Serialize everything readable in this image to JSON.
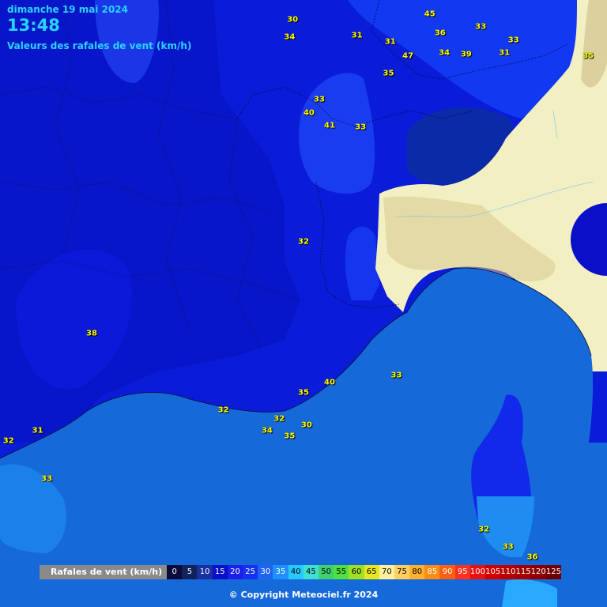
{
  "header": {
    "date": "dimanche 19 mai 2024",
    "time": "13:48",
    "subtitle": "Valeurs des rafales de vent (km/h)"
  },
  "labels": [
    {
      "text": "30",
      "lon": 0.482,
      "lat": 0.032
    },
    {
      "text": "34",
      "lon": 0.477,
      "lat": 0.061
    },
    {
      "text": "31",
      "lon": 0.588,
      "lat": 0.058
    },
    {
      "text": "31",
      "lon": 0.643,
      "lat": 0.069
    },
    {
      "text": "45",
      "lon": 0.708,
      "lat": 0.023
    },
    {
      "text": "36",
      "lon": 0.725,
      "lat": 0.055
    },
    {
      "text": "33",
      "lon": 0.792,
      "lat": 0.044
    },
    {
      "text": "33",
      "lon": 0.846,
      "lat": 0.066
    },
    {
      "text": "47",
      "lon": 0.672,
      "lat": 0.093
    },
    {
      "text": "34",
      "lon": 0.732,
      "lat": 0.087
    },
    {
      "text": "39",
      "lon": 0.768,
      "lat": 0.09
    },
    {
      "text": "31",
      "lon": 0.831,
      "lat": 0.087
    },
    {
      "text": "35",
      "lon": 0.969,
      "lat": 0.092
    },
    {
      "text": "35",
      "lon": 0.64,
      "lat": 0.121
    },
    {
      "text": "33",
      "lon": 0.526,
      "lat": 0.164
    },
    {
      "text": "40",
      "lon": 0.509,
      "lat": 0.186
    },
    {
      "text": "41",
      "lon": 0.543,
      "lat": 0.207
    },
    {
      "text": "33",
      "lon": 0.594,
      "lat": 0.209
    },
    {
      "text": "32",
      "lon": 0.5,
      "lat": 0.398
    },
    {
      "text": "38",
      "lon": 0.151,
      "lat": 0.55
    },
    {
      "text": "33",
      "lon": 0.653,
      "lat": 0.618
    },
    {
      "text": "40",
      "lon": 0.543,
      "lat": 0.63
    },
    {
      "text": "35",
      "lon": 0.5,
      "lat": 0.647
    },
    {
      "text": "32",
      "lon": 0.368,
      "lat": 0.676
    },
    {
      "text": "32",
      "lon": 0.46,
      "lat": 0.69
    },
    {
      "text": "30",
      "lon": 0.505,
      "lat": 0.701
    },
    {
      "text": "34",
      "lon": 0.44,
      "lat": 0.71
    },
    {
      "text": "35",
      "lon": 0.477,
      "lat": 0.719
    },
    {
      "text": "31",
      "lon": 0.062,
      "lat": 0.71
    },
    {
      "text": "32",
      "lon": 0.014,
      "lat": 0.726
    },
    {
      "text": "33",
      "lon": 0.077,
      "lat": 0.789
    },
    {
      "text": "32",
      "lon": 0.797,
      "lat": 0.872
    },
    {
      "text": "33",
      "lon": 0.837,
      "lat": 0.901
    },
    {
      "text": "36",
      "lon": 0.877,
      "lat": 0.918
    }
  ],
  "legend": {
    "title": "Rafales de vent (km/h)",
    "items": [
      {
        "value": "0",
        "bg": "#0b0b3a",
        "fg": "#ffffff"
      },
      {
        "value": "5",
        "bg": "#12235a",
        "fg": "#ffffff"
      },
      {
        "value": "10",
        "bg": "#1a2fa0",
        "fg": "#ffffff"
      },
      {
        "value": "15",
        "bg": "#0a10c8",
        "fg": "#ffffff"
      },
      {
        "value": "20",
        "bg": "#1a20e8",
        "fg": "#ffffff"
      },
      {
        "value": "25",
        "bg": "#1430f0",
        "fg": "#ffffff"
      },
      {
        "value": "30",
        "bg": "#1e64f0",
        "fg": "#ffffff"
      },
      {
        "value": "35",
        "bg": "#1e90ff",
        "fg": "#ffffff"
      },
      {
        "value": "40",
        "bg": "#28c8ff",
        "fg": "#000000"
      },
      {
        "value": "45",
        "bg": "#40e0d0",
        "fg": "#000000"
      },
      {
        "value": "50",
        "bg": "#40d070",
        "fg": "#000000"
      },
      {
        "value": "55",
        "bg": "#50e040",
        "fg": "#000000"
      },
      {
        "value": "60",
        "bg": "#a0e020",
        "fg": "#000000"
      },
      {
        "value": "65",
        "bg": "#e8e820",
        "fg": "#000000"
      },
      {
        "value": "70",
        "bg": "#fff0a0",
        "fg": "#000000"
      },
      {
        "value": "75",
        "bg": "#ffd060",
        "fg": "#000000"
      },
      {
        "value": "80",
        "bg": "#ffb030",
        "fg": "#000000"
      },
      {
        "value": "85",
        "bg": "#ff8c10",
        "fg": "#ffffff"
      },
      {
        "value": "90",
        "bg": "#ff6010",
        "fg": "#ffffff"
      },
      {
        "value": "95",
        "bg": "#ff3020",
        "fg": "#ffffff"
      },
      {
        "value": "100",
        "bg": "#e81010",
        "fg": "#ffffff"
      },
      {
        "value": "105",
        "bg": "#d00000",
        "fg": "#ffffff"
      },
      {
        "value": "110",
        "bg": "#b80000",
        "fg": "#ffffff"
      },
      {
        "value": "115",
        "bg": "#a00000",
        "fg": "#ffffff"
      },
      {
        "value": "120",
        "bg": "#880000",
        "fg": "#ffffff"
      },
      {
        "value": "125",
        "bg": "#700000",
        "fg": "#ffffff"
      }
    ]
  },
  "copyright": "© Copyright Meteociel.fr 2024"
}
